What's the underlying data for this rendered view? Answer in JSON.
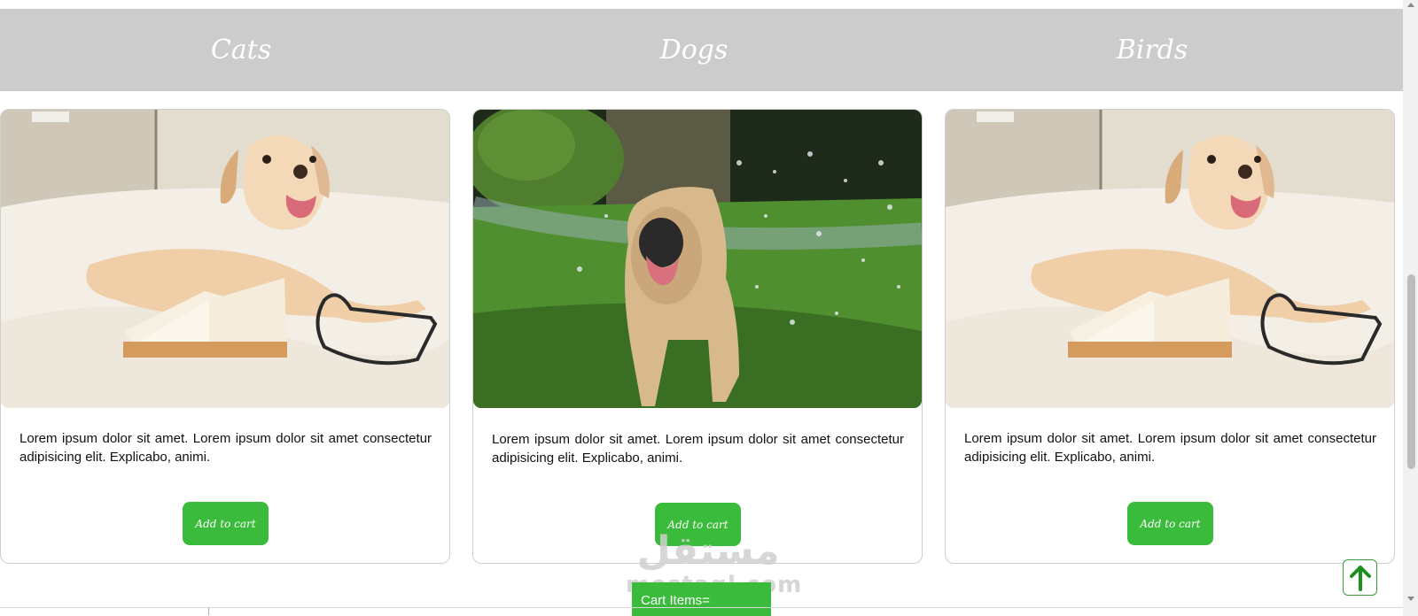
{
  "categories": [
    {
      "label": "Cats"
    },
    {
      "label": "Dogs"
    },
    {
      "label": "Birds"
    }
  ],
  "cards": [
    {
      "image": "dog-on-bed-with-book",
      "description": "Lorem ipsum dolor sit amet. Lorem ipsum dolor sit amet consectetur adipisicing elit. Explicabo, animi.",
      "button_label": "Add to cart"
    },
    {
      "image": "dog-in-water-spray",
      "description": "Lorem ipsum dolor sit amet. Lorem ipsum dolor sit amet consectetur adipisicing elit. Explicabo, animi.",
      "button_label": "Add to cart"
    },
    {
      "image": "dog-on-bed-with-book",
      "description": "Lorem ipsum dolor sit amet. Lorem ipsum dolor sit amet consectetur adipisicing elit. Explicabo, animi.",
      "button_label": "Add to cart"
    }
  ],
  "cart": {
    "label": "Cart Items="
  },
  "scroll_top": {
    "icon": "arrow-up-icon"
  },
  "watermark": {
    "logo": "مستقل",
    "text": "mostaql.com"
  },
  "colors": {
    "category_bar": "#cccccc",
    "accent_green": "#3bbb3b",
    "card_border": "#cfcfcf"
  }
}
